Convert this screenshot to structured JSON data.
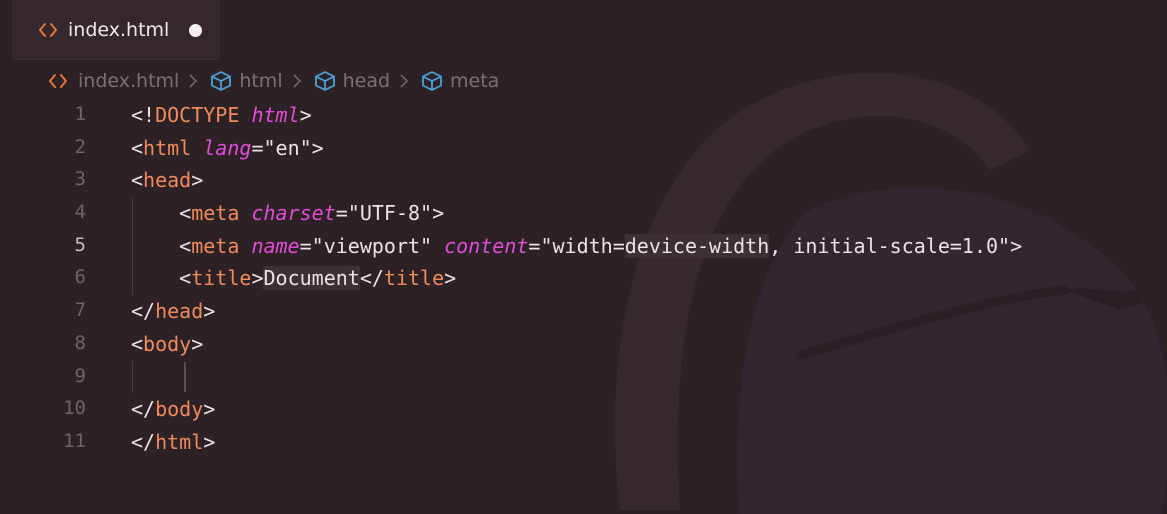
{
  "tab": {
    "filename": "index.html",
    "icon": "html-code-icon",
    "dirty": true
  },
  "breadcrumb": [
    {
      "label": "index.html",
      "icon": "html-code-icon"
    },
    {
      "label": "html",
      "icon": "element-box-icon"
    },
    {
      "label": "head",
      "icon": "element-box-icon"
    },
    {
      "label": "meta",
      "icon": "element-box-icon"
    }
  ],
  "editor": {
    "active_line": 5,
    "lines": [
      {
        "number": "1",
        "indent": "",
        "tokens": [
          {
            "t": "punc",
            "v": "<!"
          },
          {
            "t": "tag",
            "v": "DOCTYPE"
          },
          {
            "t": "punc",
            "v": " "
          },
          {
            "t": "attr",
            "v": "html"
          },
          {
            "t": "punc",
            "v": ">"
          }
        ]
      },
      {
        "number": "2",
        "indent": "",
        "tokens": [
          {
            "t": "punc",
            "v": "<"
          },
          {
            "t": "tag",
            "v": "html"
          },
          {
            "t": "punc",
            "v": " "
          },
          {
            "t": "attr",
            "v": "lang"
          },
          {
            "t": "punc",
            "v": "="
          },
          {
            "t": "str",
            "v": "\"en\""
          },
          {
            "t": "punc",
            "v": ">"
          }
        ]
      },
      {
        "number": "3",
        "indent": "",
        "tokens": [
          {
            "t": "punc",
            "v": "<"
          },
          {
            "t": "tag",
            "v": "head"
          },
          {
            "t": "punc",
            "v": ">"
          }
        ]
      },
      {
        "number": "4",
        "indent": "    ",
        "tokens": [
          {
            "t": "punc",
            "v": "<"
          },
          {
            "t": "tag",
            "v": "meta"
          },
          {
            "t": "punc",
            "v": " "
          },
          {
            "t": "attr",
            "v": "charset"
          },
          {
            "t": "punc",
            "v": "="
          },
          {
            "t": "str",
            "v": "\"UTF-8\""
          },
          {
            "t": "punc",
            "v": ">"
          }
        ]
      },
      {
        "number": "5",
        "indent": "    ",
        "tokens": [
          {
            "t": "punc",
            "v": "<"
          },
          {
            "t": "tag",
            "v": "meta"
          },
          {
            "t": "punc",
            "v": " "
          },
          {
            "t": "attr",
            "v": "name"
          },
          {
            "t": "punc",
            "v": "="
          },
          {
            "t": "str",
            "v": "\"viewport\""
          },
          {
            "t": "punc",
            "v": " "
          },
          {
            "t": "attr",
            "v": "content"
          },
          {
            "t": "punc",
            "v": "="
          },
          {
            "t": "str",
            "v": "\"width="
          },
          {
            "t": "str",
            "v": "device-width",
            "hl": true
          },
          {
            "t": "str",
            "v": ", initial-scale=1.0\""
          },
          {
            "t": "punc",
            "v": ">"
          }
        ]
      },
      {
        "number": "6",
        "indent": "    ",
        "tokens": [
          {
            "t": "punc",
            "v": "<"
          },
          {
            "t": "tag",
            "v": "title"
          },
          {
            "t": "punc",
            "v": ">"
          },
          {
            "t": "text",
            "v": "Document",
            "hl": true
          },
          {
            "t": "punc",
            "v": "</"
          },
          {
            "t": "tag",
            "v": "title"
          },
          {
            "t": "punc",
            "v": ">"
          }
        ]
      },
      {
        "number": "7",
        "indent": "",
        "tokens": [
          {
            "t": "punc",
            "v": "</"
          },
          {
            "t": "tag",
            "v": "head"
          },
          {
            "t": "punc",
            "v": ">"
          }
        ]
      },
      {
        "number": "8",
        "indent": "",
        "tokens": [
          {
            "t": "punc",
            "v": "<"
          },
          {
            "t": "tag",
            "v": "body"
          },
          {
            "t": "punc",
            "v": ">"
          }
        ]
      },
      {
        "number": "9",
        "indent": "",
        "tokens": []
      },
      {
        "number": "10",
        "indent": "",
        "tokens": [
          {
            "t": "punc",
            "v": "</"
          },
          {
            "t": "tag",
            "v": "body"
          },
          {
            "t": "punc",
            "v": ">"
          }
        ]
      },
      {
        "number": "11",
        "indent": "",
        "tokens": [
          {
            "t": "punc",
            "v": "</"
          },
          {
            "t": "tag",
            "v": "html"
          },
          {
            "t": "punc",
            "v": ">"
          }
        ]
      }
    ]
  },
  "colors": {
    "background": "#2c2226",
    "tag": "#f08a5c",
    "attribute": "#e24cd6",
    "text": "#ece3e6",
    "line_number": "#6f6368",
    "active_line_number": "#c7bfc2",
    "icon_orange": "#e8743b",
    "icon_blue": "#4aa3d8"
  }
}
